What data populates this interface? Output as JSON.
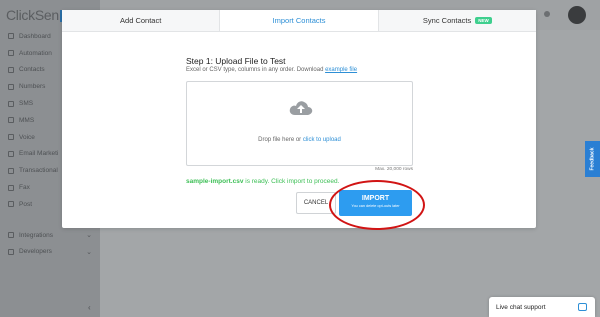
{
  "app": {
    "logo_text": "ClickSen",
    "nav_items": [
      {
        "label": "Dashboard",
        "icon": "dashboard-icon"
      },
      {
        "label": "Automation",
        "icon": "automation-icon"
      },
      {
        "label": "Contacts",
        "icon": "contacts-icon"
      },
      {
        "label": "Numbers",
        "icon": "numbers-icon"
      },
      {
        "label": "SMS",
        "icon": "sms-icon"
      },
      {
        "label": "MMS",
        "icon": "mms-icon"
      },
      {
        "label": "Voice",
        "icon": "voice-icon"
      },
      {
        "label": "Email Marketi",
        "icon": "email-icon"
      },
      {
        "label": "Transactional",
        "icon": "transactional-icon"
      },
      {
        "label": "Fax",
        "icon": "fax-icon"
      },
      {
        "label": "Post",
        "icon": "post-icon"
      }
    ],
    "nav_secondary": [
      {
        "label": "Integrations",
        "icon": "integrations-icon"
      },
      {
        "label": "Developers",
        "icon": "developers-icon"
      }
    ]
  },
  "modal": {
    "tabs": [
      {
        "label": "Add Contact"
      },
      {
        "label": "Import Contacts"
      },
      {
        "label": "Sync Contacts"
      }
    ],
    "sync_badge": "NEW",
    "step_title": "Step 1: Upload File to Test",
    "step_sub": "Excel or CSV type, columns in any order. Download ",
    "example_link": "example file",
    "drop_text": "Drop file here or ",
    "drop_link": "click to upload",
    "max_rows": "Max. 20,000 rows",
    "ready_file": "sample-import.csv",
    "ready_text": " is ready. Click import to proceed.",
    "cancel_label": "CANCEL",
    "import_label": "IMPORT",
    "import_sub": "You can delete opt-outs later"
  },
  "feedback_label": "Feedback",
  "chat_label": "Live chat support",
  "colors": {
    "accent": "#2d9cf0",
    "success": "#3cbf55",
    "highlight": "#d11414",
    "feedback": "#2a7fd4"
  }
}
